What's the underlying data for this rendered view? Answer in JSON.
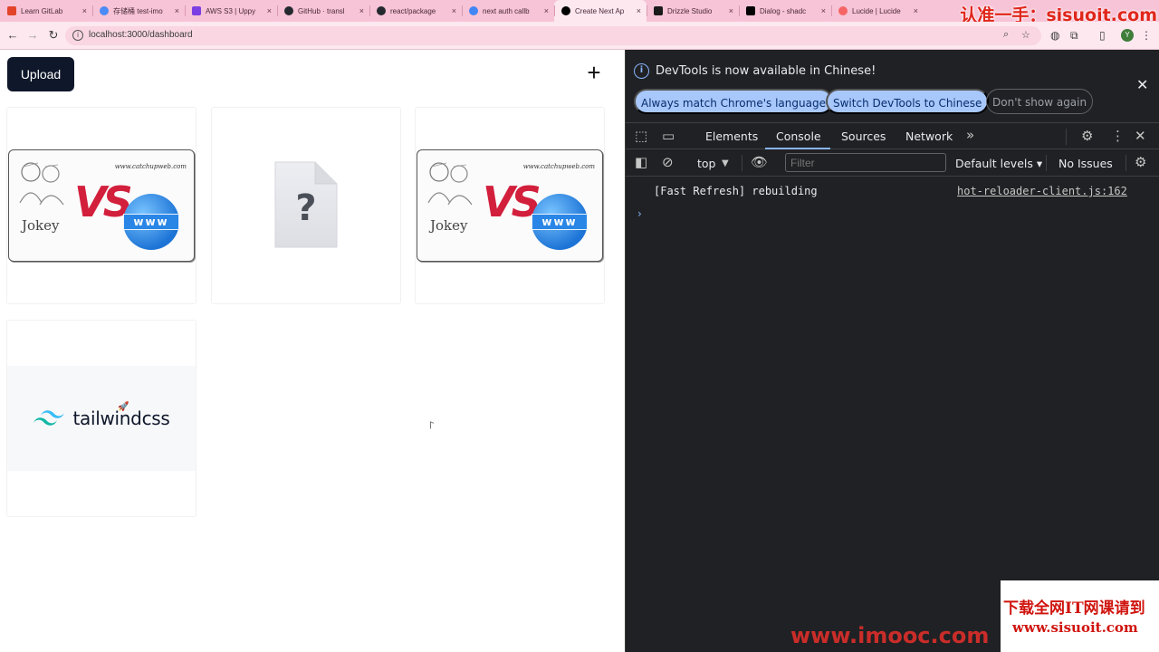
{
  "browser": {
    "tabs": [
      {
        "title": "Learn GitLab",
        "color": "#e24329",
        "active": false
      },
      {
        "title": "存储桶 test-imo",
        "color": "#4c8bf5",
        "active": false
      },
      {
        "title": "AWS S3 | Uppy",
        "color": "#7b3fe4",
        "active": false
      },
      {
        "title": "GitHub · transl",
        "color": "#24292f",
        "active": false
      },
      {
        "title": "react/package",
        "color": "#24292f",
        "active": false
      },
      {
        "title": "next auth callb",
        "color": "#4285f4",
        "active": false
      },
      {
        "title": "Create Next Ap",
        "color": "#000000",
        "active": true
      },
      {
        "title": "Drizzle Studio",
        "color": "#1a1a1a",
        "active": false
      },
      {
        "title": "Dialog - shadc",
        "color": "#000000",
        "active": false
      },
      {
        "title": "Lucide | Lucide",
        "color": "#f56565",
        "active": false
      }
    ],
    "tab_close_glyph": "×",
    "url": "localhost:3000/dashboard",
    "profile_initial": "Y"
  },
  "watermarks": {
    "top_right": "认准一手：sisuoit.com",
    "bottom_line1": "下载全网IT网课请到",
    "bottom_line2": "www.sisuoit.com",
    "bottom_imooc": "www.imooc.com"
  },
  "dashboard": {
    "upload_label": "Upload",
    "add_glyph": "+",
    "cards": [
      {
        "kind": "vs",
        "site": "www.catchupweb.com",
        "left_label": "Jokey",
        "vs": "VS",
        "globe_label": "www"
      },
      {
        "kind": "missing",
        "glyph": "?"
      },
      {
        "kind": "vs",
        "site": "www.catchupweb.com",
        "left_label": "Jokey",
        "vs": "VS",
        "globe_label": "www"
      },
      {
        "kind": "tailwind",
        "brand": "tailwindcss"
      }
    ]
  },
  "devtools": {
    "banner": {
      "message": "DevTools is now available in Chinese!",
      "buttons": [
        "Always match Chrome's language",
        "Switch DevTools to Chinese",
        "Don't show again"
      ]
    },
    "tabs": [
      "Elements",
      "Console",
      "Sources",
      "Network"
    ],
    "active_tab": "Console",
    "console_toolbar": {
      "context": "top",
      "filter_placeholder": "Filter",
      "levels": "Default levels ▾",
      "issues": "No Issues"
    },
    "logs": [
      {
        "message": "[Fast Refresh] rebuilding",
        "source": "hot-reloader-client.js:162"
      }
    ],
    "prompt_glyph": "›"
  }
}
